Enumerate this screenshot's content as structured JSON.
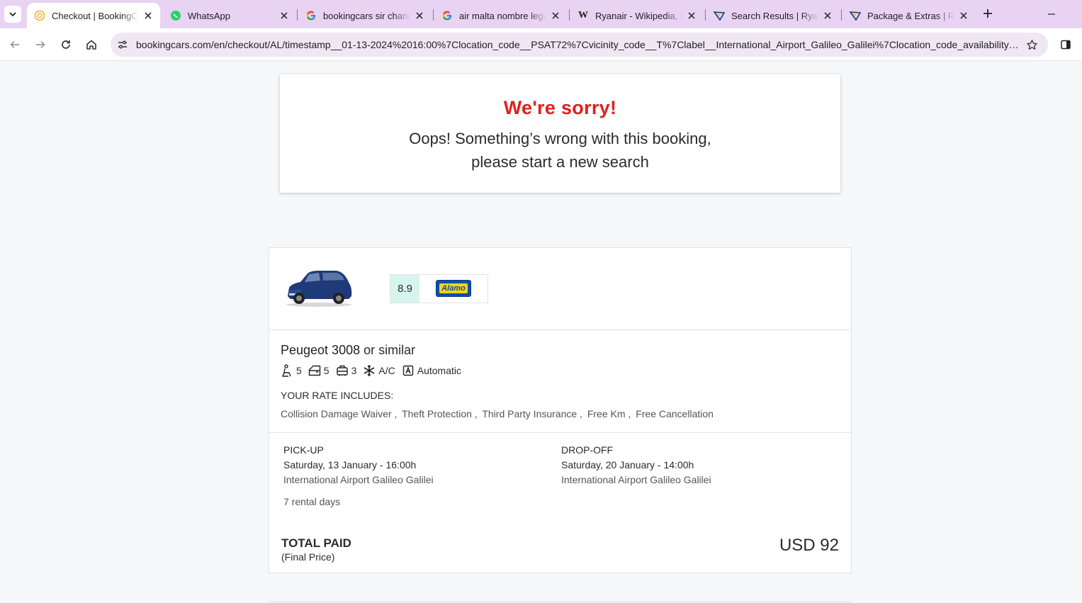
{
  "browser": {
    "tabs": [
      {
        "title": "Checkout | BookingCars",
        "favicon": "bookingcars-icon",
        "active": true
      },
      {
        "title": "WhatsApp",
        "favicon": "whatsapp-icon",
        "active": false
      },
      {
        "title": "bookingcars sir chandler",
        "favicon": "google-icon",
        "active": false
      },
      {
        "title": "air malta nombre legal",
        "favicon": "google-icon",
        "active": false
      },
      {
        "title": "Ryanair - Wikipedia, la enciclopedia",
        "favicon": "wikipedia-icon",
        "active": false
      },
      {
        "title": "Search Results | Ryanair",
        "favicon": "ryanair-icon",
        "active": false
      },
      {
        "title": "Package & Extras | Ryanair",
        "favicon": "ryanair-icon",
        "active": false
      }
    ],
    "url": "bookingcars.com/en/checkout/AL/timestamp__01-13-2024%2016:00%7Clocation_code__PSAT72%7Cvicinity_code__T%7Clabel__International_Airport_Galileo_Galilei%7Clocation_code_availability__PSA%..."
  },
  "error": {
    "title": "We're sorry!",
    "line1": "Oops! Something’s wrong with this booking,",
    "line2": "please start a new search"
  },
  "car": {
    "name": "Peugeot 3008",
    "similar": "or similar",
    "rating": "8.9",
    "supplier": "Alamo",
    "specs": {
      "seats": "5",
      "doors": "5",
      "bags": "3",
      "ac": "A/C",
      "transmission": "Automatic"
    },
    "includes_label": "YOUR RATE INCLUDES:",
    "includes": [
      "Collision Damage Waiver ,",
      "Theft Protection ,",
      "Third Party Insurance ,",
      "Free Km ,",
      "Free Cancellation"
    ]
  },
  "trip": {
    "pickup": {
      "label": "PICK-UP",
      "date": "Saturday, 13 January - 16:00h",
      "place": "International Airport Galileo Galilei"
    },
    "dropoff": {
      "label": "DROP-OFF",
      "date": "Saturday, 20 January - 14:00h",
      "place": "International Airport Galileo Galilei"
    },
    "rental_days": "7 rental days"
  },
  "total": {
    "label": "TOTAL PAID",
    "sub": "(Final Price)",
    "amount": "USD 92"
  },
  "colors": {
    "error_red": "#e01f1f",
    "score_bg": "#d6f5ec",
    "tabbar_bg": "#e9d3f3"
  }
}
